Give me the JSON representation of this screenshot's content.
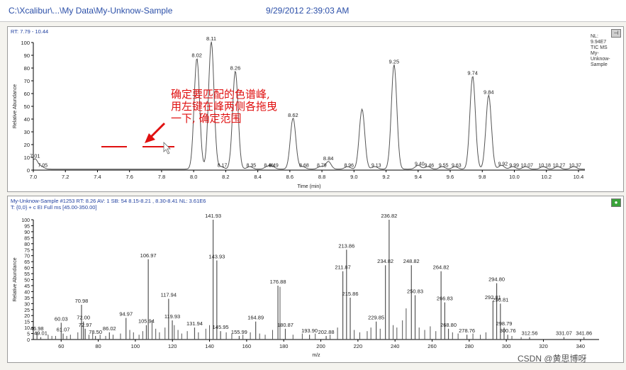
{
  "window": {
    "path": "C:\\Xcalibur\\...\\My Data\\My-Unknow-Sample",
    "datetime": "9/29/2012 2:39:03 AM"
  },
  "chromatogram": {
    "rt_label": "RT: 7.79 - 10.44",
    "side_info": [
      "NL:",
      "9.94E7",
      "TIC  MS",
      "My-",
      "Unknow-",
      "Sample"
    ],
    "annotation": [
      "确定要匹配的色谱峰,",
      "用左键在峰两侧各拖曳",
      "一下, 确定范围"
    ]
  },
  "spectrum": {
    "header_line1": "My-Unknow-Sample #1253  RT: 8.26  AV: 1  SB: 54  8.15-8.21 , 8.30-8.41  NL: 3.61E6",
    "header_line2": "T: {0,0}  + c EI Full ms [45.00-350.00]"
  },
  "watermark": "CSDN @黄思博呀",
  "colors": {
    "trace": "#555555",
    "axis": "#000000",
    "annotation": "#e01010",
    "header_text": "#1f3f9f"
  },
  "chart_data": [
    {
      "type": "line",
      "xlabel": "Time (min)",
      "ylabel": "Relative Abundance",
      "xlim": [
        7.0,
        10.44
      ],
      "ylim": [
        0,
        100
      ],
      "x_ticks": [
        7.0,
        7.2,
        7.4,
        7.6,
        7.8,
        8.0,
        8.2,
        8.4,
        8.6,
        8.8,
        9.0,
        9.2,
        9.4,
        9.6,
        9.8,
        10.0,
        10.2,
        10.4
      ],
      "y_ticks": [
        0,
        10,
        20,
        30,
        40,
        50,
        60,
        70,
        80,
        90,
        100
      ],
      "peaks": [
        {
          "rt": 7.01,
          "height": 8,
          "label": "7.01"
        },
        {
          "rt": 8.02,
          "height": 87,
          "label": "8.02"
        },
        {
          "rt": 8.11,
          "height": 100,
          "label": "8.11"
        },
        {
          "rt": 8.26,
          "height": 77,
          "label": "8.26"
        },
        {
          "rt": 8.62,
          "height": 40,
          "label": "8.62"
        },
        {
          "rt": 8.84,
          "height": 6,
          "label": "8.84"
        },
        {
          "rt": 9.05,
          "height": 47,
          "label": ""
        },
        {
          "rt": 9.25,
          "height": 82,
          "label": "9.25"
        },
        {
          "rt": 9.74,
          "height": 73,
          "label": "9.74"
        },
        {
          "rt": 9.84,
          "height": 58,
          "label": "9.84"
        }
      ],
      "minor_labels": [
        {
          "rt": 7.05,
          "height": 2,
          "label": "7.05"
        },
        {
          "rt": 8.17,
          "height": 2,
          "label": "8.17"
        },
        {
          "rt": 8.35,
          "height": 2,
          "label": "8.35"
        },
        {
          "rt": 8.46,
          "height": 2,
          "label": "8.46"
        },
        {
          "rt": 8.49,
          "height": 2,
          "label": "8.49"
        },
        {
          "rt": 8.68,
          "height": 2,
          "label": "8.68"
        },
        {
          "rt": 8.79,
          "height": 2,
          "label": "8.79"
        },
        {
          "rt": 8.96,
          "height": 2,
          "label": "8.96"
        },
        {
          "rt": 9.13,
          "height": 2,
          "label": "9.13"
        },
        {
          "rt": 9.4,
          "height": 3,
          "label": "9.40"
        },
        {
          "rt": 9.46,
          "height": 2,
          "label": "9.46"
        },
        {
          "rt": 9.55,
          "height": 2,
          "label": "9.55"
        },
        {
          "rt": 9.63,
          "height": 2,
          "label": "9.63"
        },
        {
          "rt": 9.92,
          "height": 3,
          "label": "9.92"
        },
        {
          "rt": 9.99,
          "height": 2,
          "label": "9.99"
        },
        {
          "rt": 10.07,
          "height": 2,
          "label": "10.07"
        },
        {
          "rt": 10.18,
          "height": 2,
          "label": "10.18"
        },
        {
          "rt": 10.27,
          "height": 2,
          "label": "10.27"
        },
        {
          "rt": 10.37,
          "height": 2,
          "label": "10.37"
        }
      ]
    },
    {
      "type": "bar",
      "xlabel": "m/z",
      "ylabel": "Relative Abundance",
      "xlim": [
        45,
        350
      ],
      "ylim": [
        0,
        100
      ],
      "x_ticks": [
        60,
        80,
        100,
        120,
        140,
        160,
        180,
        200,
        220,
        240,
        260,
        280,
        300,
        320,
        340
      ],
      "y_ticks": [
        0,
        5,
        10,
        15,
        20,
        25,
        30,
        35,
        40,
        45,
        50,
        55,
        60,
        65,
        70,
        75,
        80,
        85,
        90,
        95,
        100
      ],
      "peaks": [
        {
          "mz": 46.98,
          "value": 6
        },
        {
          "mz": 49.01,
          "value": 2
        },
        {
          "mz": 60.03,
          "value": 14
        },
        {
          "mz": 61.07,
          "value": 5
        },
        {
          "mz": 70.98,
          "value": 29
        },
        {
          "mz": 72.0,
          "value": 15
        },
        {
          "mz": 72.97,
          "value": 9
        },
        {
          "mz": 78.5,
          "value": 3
        },
        {
          "mz": 86.02,
          "value": 6
        },
        {
          "mz": 94.97,
          "value": 18
        },
        {
          "mz": 105.94,
          "value": 12
        },
        {
          "mz": 106.97,
          "value": 67
        },
        {
          "mz": 117.94,
          "value": 34
        },
        {
          "mz": 119.93,
          "value": 16
        },
        {
          "mz": 131.94,
          "value": 10
        },
        {
          "mz": 141.93,
          "value": 100
        },
        {
          "mz": 143.93,
          "value": 66
        },
        {
          "mz": 145.95,
          "value": 7
        },
        {
          "mz": 155.99,
          "value": 3
        },
        {
          "mz": 164.89,
          "value": 15
        },
        {
          "mz": 176.88,
          "value": 45
        },
        {
          "mz": 180.87,
          "value": 9
        },
        {
          "mz": 193.9,
          "value": 4
        },
        {
          "mz": 202.88,
          "value": 3
        },
        {
          "mz": 211.87,
          "value": 57
        },
        {
          "mz": 213.86,
          "value": 75
        },
        {
          "mz": 215.86,
          "value": 35
        },
        {
          "mz": 229.85,
          "value": 15
        },
        {
          "mz": 234.82,
          "value": 62
        },
        {
          "mz": 236.82,
          "value": 100
        },
        {
          "mz": 248.82,
          "value": 62
        },
        {
          "mz": 250.83,
          "value": 37
        },
        {
          "mz": 264.82,
          "value": 57
        },
        {
          "mz": 266.83,
          "value": 31
        },
        {
          "mz": 268.8,
          "value": 9
        },
        {
          "mz": 278.76,
          "value": 4
        },
        {
          "mz": 292.81,
          "value": 32
        },
        {
          "mz": 294.8,
          "value": 47
        },
        {
          "mz": 296.81,
          "value": 30
        },
        {
          "mz": 298.79,
          "value": 10
        },
        {
          "mz": 300.76,
          "value": 4
        },
        {
          "mz": 312.56,
          "value": 2
        },
        {
          "mz": 331.07,
          "value": 2
        },
        {
          "mz": 341.86,
          "value": 2
        }
      ],
      "minor_peaks": [
        {
          "mz": 53,
          "value": 4
        },
        {
          "mz": 55,
          "value": 3
        },
        {
          "mz": 57,
          "value": 3
        },
        {
          "mz": 63,
          "value": 3
        },
        {
          "mz": 65,
          "value": 4
        },
        {
          "mz": 69,
          "value": 6
        },
        {
          "mz": 75,
          "value": 4
        },
        {
          "mz": 77,
          "value": 5
        },
        {
          "mz": 81,
          "value": 4
        },
        {
          "mz": 84,
          "value": 3
        },
        {
          "mz": 88,
          "value": 4
        },
        {
          "mz": 92,
          "value": 5
        },
        {
          "mz": 97,
          "value": 8
        },
        {
          "mz": 99,
          "value": 6
        },
        {
          "mz": 102,
          "value": 4
        },
        {
          "mz": 104,
          "value": 7
        },
        {
          "mz": 109,
          "value": 16
        },
        {
          "mz": 111,
          "value": 9
        },
        {
          "mz": 113,
          "value": 6
        },
        {
          "mz": 116,
          "value": 10
        },
        {
          "mz": 121,
          "value": 12
        },
        {
          "mz": 123,
          "value": 8
        },
        {
          "mz": 125,
          "value": 5
        },
        {
          "mz": 128,
          "value": 7
        },
        {
          "mz": 134,
          "value": 6
        },
        {
          "mz": 138,
          "value": 9
        },
        {
          "mz": 140,
          "value": 12
        },
        {
          "mz": 149,
          "value": 6
        },
        {
          "mz": 152,
          "value": 5
        },
        {
          "mz": 158,
          "value": 4
        },
        {
          "mz": 162,
          "value": 6
        },
        {
          "mz": 167,
          "value": 5
        },
        {
          "mz": 170,
          "value": 4
        },
        {
          "mz": 174,
          "value": 8
        },
        {
          "mz": 178,
          "value": 44
        },
        {
          "mz": 185,
          "value": 4
        },
        {
          "mz": 190,
          "value": 5
        },
        {
          "mz": 197,
          "value": 5
        },
        {
          "mz": 205,
          "value": 4
        },
        {
          "mz": 209,
          "value": 10
        },
        {
          "mz": 218,
          "value": 8
        },
        {
          "mz": 221,
          "value": 6
        },
        {
          "mz": 225,
          "value": 7
        },
        {
          "mz": 227,
          "value": 10
        },
        {
          "mz": 232,
          "value": 9
        },
        {
          "mz": 239,
          "value": 12
        },
        {
          "mz": 241,
          "value": 10
        },
        {
          "mz": 244,
          "value": 16
        },
        {
          "mz": 246,
          "value": 26
        },
        {
          "mz": 253,
          "value": 10
        },
        {
          "mz": 256,
          "value": 8
        },
        {
          "mz": 259,
          "value": 11
        },
        {
          "mz": 262,
          "value": 7
        },
        {
          "mz": 271,
          "value": 6
        },
        {
          "mz": 274,
          "value": 5
        },
        {
          "mz": 282,
          "value": 5
        },
        {
          "mz": 286,
          "value": 4
        },
        {
          "mz": 289,
          "value": 6
        },
        {
          "mz": 303,
          "value": 3
        },
        {
          "mz": 308,
          "value": 2
        }
      ]
    }
  ]
}
